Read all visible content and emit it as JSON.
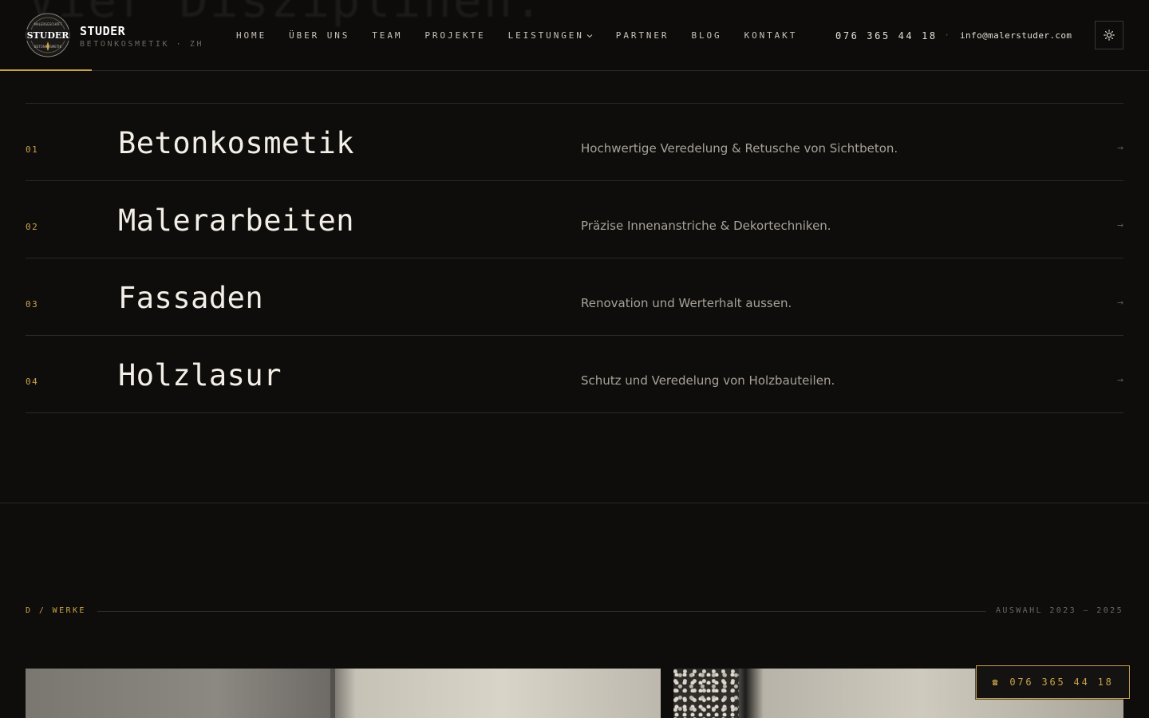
{
  "header": {
    "ghost_heading": "Vier Disziplinen.",
    "brand_name": "STUDER",
    "brand_sub": "BETONKOSMETIK · ZH",
    "logo_text_top": "MALERGESCHÄFT",
    "logo_text_main": "STUDER",
    "logo_text_bottom": "BETONKOSMETIK",
    "nav": [
      {
        "label": "HOME"
      },
      {
        "label": "ÜBER UNS"
      },
      {
        "label": "TEAM"
      },
      {
        "label": "PROJEKTE"
      },
      {
        "label": "LEISTUNGEN"
      },
      {
        "label": "PARTNER"
      },
      {
        "label": "BLOG"
      },
      {
        "label": "KONTAKT"
      }
    ],
    "phone": "076 365 44 18",
    "separator": "·",
    "email": "info@malerstuder.com"
  },
  "disciplines": [
    {
      "num": "01",
      "title": "Betonkosmetik",
      "desc": "Hochwertige Veredelung & Retusche von Sichtbeton.",
      "arrow": "→"
    },
    {
      "num": "02",
      "title": "Malerarbeiten",
      "desc": "Präzise Innenanstriche & Dekortechniken.",
      "arrow": "→"
    },
    {
      "num": "03",
      "title": "Fassaden",
      "desc": "Renovation und Werterhalt aussen.",
      "arrow": "→"
    },
    {
      "num": "04",
      "title": "Holzlasur",
      "desc": "Schutz und Veredelung von Holzbauteilen.",
      "arrow": "→"
    }
  ],
  "works": {
    "label": "D / WERKE",
    "range": "AUSWAHL 2023 — 2025"
  },
  "call_button": {
    "icon": "☎",
    "label": "076 365 44 18"
  },
  "colors": {
    "background": "#0e0d0c",
    "accent": "#c9a24a",
    "text": "#ece6db",
    "muted": "#a8a298"
  }
}
